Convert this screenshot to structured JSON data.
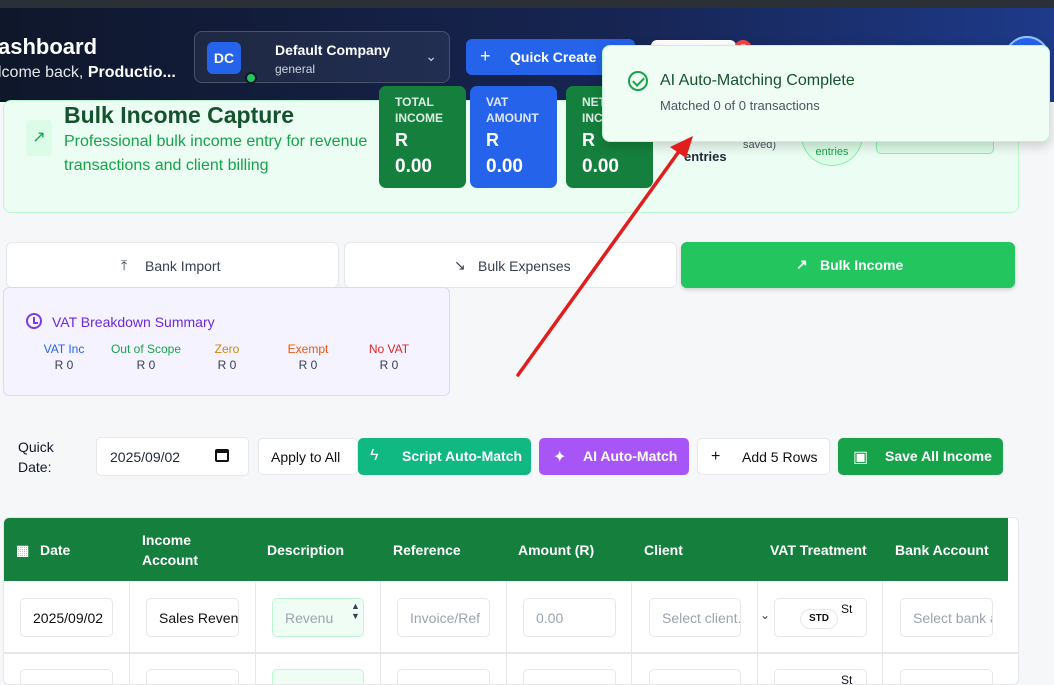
{
  "header": {
    "title": "ashboard",
    "welcome_prefix": "lcome back, ",
    "welcome_name": "Productio...",
    "company": {
      "initials": "DC",
      "name": "Default Company",
      "sub": "general"
    },
    "quick_create": "Quick Create",
    "notification_count": "5"
  },
  "summary": {
    "title": "Bulk Income Capture",
    "description": "Professional bulk income entry for revenue transactions and client billing",
    "stats": [
      {
        "label": "TOTAL INCOME",
        "currency": "R",
        "value": "0.00"
      },
      {
        "label": "VAT AMOUNT",
        "currency": "R",
        "value": "0.00"
      },
      {
        "label": "NET INCOME",
        "currency": "R",
        "value": "0.00"
      }
    ],
    "entries_label": "entries",
    "saved_label": "saved)",
    "circle_label": "entries"
  },
  "tabs": [
    {
      "label": "Bank Import",
      "icon": "upload-icon"
    },
    {
      "label": "Bulk Expenses",
      "icon": "trending-down-icon"
    },
    {
      "label": "Bulk Income",
      "icon": "trending-up-icon"
    }
  ],
  "vat": {
    "title": "VAT Breakdown Summary",
    "items": [
      {
        "label": "VAT Inc",
        "value": "R 0",
        "color": "#2563eb"
      },
      {
        "label": "Out of Scope",
        "value": "R 0",
        "color": "#16a34a"
      },
      {
        "label": "Zero",
        "value": "R 0",
        "color": "#ca8a04"
      },
      {
        "label": "Exempt",
        "value": "R 0",
        "color": "#ea580c"
      },
      {
        "label": "No VAT",
        "value": "R 0",
        "color": "#dc2626"
      }
    ]
  },
  "toolbar": {
    "quick_date_label": "Quick Date:",
    "date_value": "2025/09/02",
    "apply": "Apply to All",
    "script": "Script Auto-Match",
    "ai": "AI Auto-Match",
    "add_rows": "Add 5 Rows",
    "save": "Save All Income"
  },
  "table": {
    "headers": [
      "Date",
      "Income Account",
      "Description",
      "Reference",
      "Amount (R)",
      "Client",
      "VAT Treatment",
      "Bank Account"
    ],
    "row": {
      "date": "2025/09/02",
      "account": "Sales Revenue",
      "description": "Revenu",
      "reference_placeholder": "Invoice/Ref",
      "amount_placeholder": "0.00",
      "client_placeholder": "Select client...",
      "vat_badge": "STD",
      "vat_text": "St",
      "bank_placeholder": "Select bank account"
    }
  },
  "toast": {
    "title": "AI Auto-Matching Complete",
    "message": "Matched 0 of 0 transactions"
  },
  "colors": {
    "primary_green": "#22c55e",
    "dark_green": "#15803d",
    "blue": "#2563eb",
    "purple": "#a855f7",
    "annotation_arrow": "#e11d1d"
  }
}
